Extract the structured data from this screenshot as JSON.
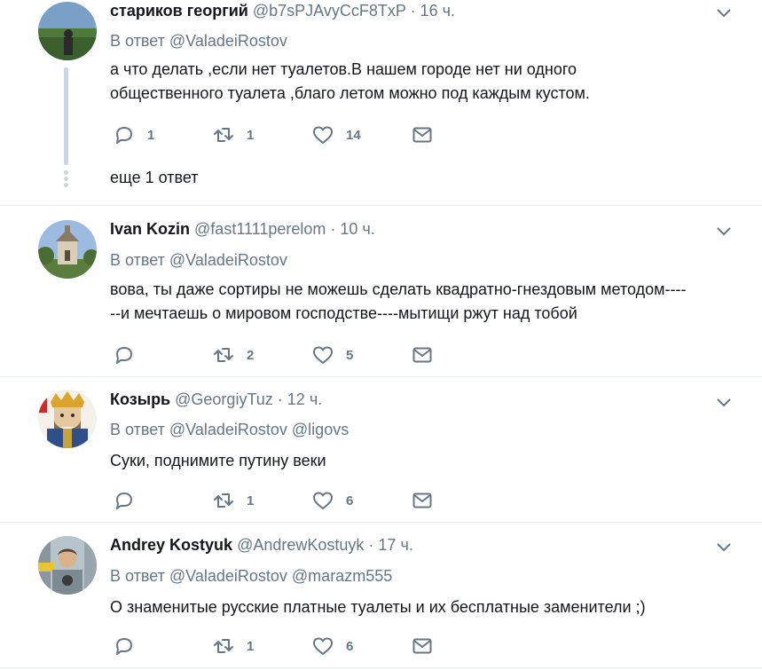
{
  "tweets": [
    {
      "name": "стариков георгий",
      "handle": "@b7sPJAvyCcF8TxP",
      "time": "· 16 ч.",
      "reply_prefix": "В ответ",
      "reply_to": "@ValadeiRostov",
      "text_lines": [
        "а что делать ,если нет туалетов.В нашем городе нет ни одного",
        "общественного туалета ,благо летом можно под каждым кустом."
      ],
      "replies": "1",
      "retweets": "1",
      "likes": "14",
      "more_replies": "еще 1 ответ"
    },
    {
      "name": "Ivan Kozin",
      "handle": "@fast1111perelom",
      "time": "· 10 ч.",
      "reply_prefix": "В ответ",
      "reply_to": "@ValadeiRostov",
      "text_lines": [
        "вова, ты даже сортиры не можешь сделать квадратно-гнездовым методом----",
        "--и мечтаешь о мировом господстве----мытищи ржут над тобой"
      ],
      "replies": "",
      "retweets": "2",
      "likes": "5"
    },
    {
      "name": "Козырь",
      "handle": "@GeorgiyTuz",
      "time": "· 12 ч.",
      "reply_prefix": "В ответ",
      "reply_to": "@ValadeiRostov @ligovs",
      "text_lines": [
        "Суки, поднимите путину веки"
      ],
      "replies": "",
      "retweets": "1",
      "likes": "6"
    },
    {
      "name": "Andrey Kostyuk",
      "handle": "@AndrewKostuyk",
      "time": "· 17 ч.",
      "reply_prefix": "В ответ",
      "reply_to": "@ValadeiRostov @marazm555",
      "text_lines": [
        "О знаменитые русские платные туалеты и их бесплатные заменители ;)"
      ],
      "replies": "",
      "retweets": "1",
      "likes": "6"
    }
  ],
  "icons": {
    "reply": "reply-icon",
    "retweet": "retweet-icon",
    "like": "heart-icon",
    "dm": "envelope-icon",
    "caret": "chevron-down-icon"
  },
  "colors": {
    "text": "#14171a",
    "muted": "#657786",
    "divider": "#e6ecf0",
    "thread": "#ccd6dd"
  }
}
